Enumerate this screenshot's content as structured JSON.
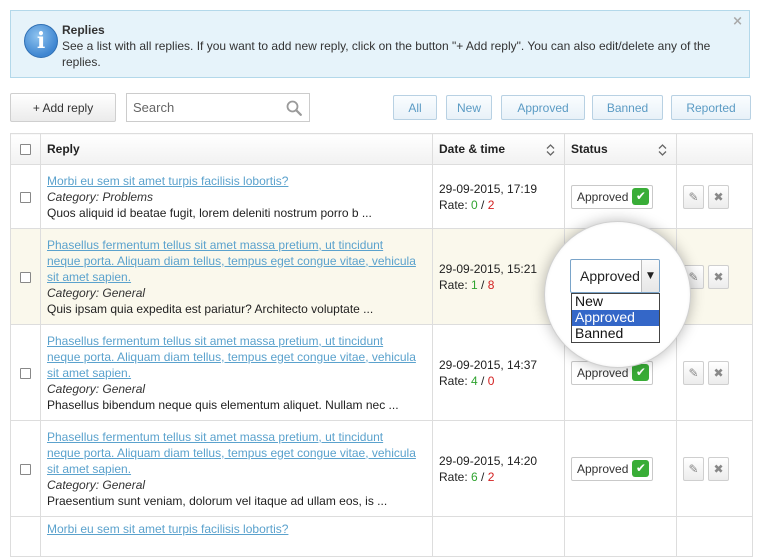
{
  "info": {
    "icon": "info-icon",
    "title": "Replies",
    "text": "See a list with all replies. If you want to add new reply, click on the button \"+ Add reply\". You can also edit/delete any of the replies.",
    "close": "×"
  },
  "toolbar": {
    "add_label": "+ Add reply",
    "search_placeholder": "Search",
    "filters": [
      "All",
      "New",
      "Approved",
      "Banned",
      "Reported"
    ]
  },
  "table": {
    "headers": {
      "reply": "Reply",
      "date": "Date & time",
      "status": "Status"
    },
    "rows": [
      {
        "title_lines": [
          "Morbi eu sem sit amet turpis facilisis lobortis?"
        ],
        "category": "Category: Problems",
        "excerpt": "Quos aliquid id beatae fugit, lorem deleniti nostrum porro b ...",
        "date": "29-09-2015, 17:19",
        "rate_label": "Rate: ",
        "rate_up": "0",
        "rate_down": "2",
        "status": "Approved"
      },
      {
        "title_lines": [
          "Phasellus fermentum tellus sit amet massa pretium, ut tincidunt",
          "neque porta. Aliquam diam tellus, tempus eget congue vitae, vehicula",
          "sit amet sapien."
        ],
        "category": "Category: General",
        "excerpt": "Quis ipsam quia expedita est pariatur? Architecto voluptate ...",
        "date": "29-09-2015, 15:21",
        "rate_label": "Rate: ",
        "rate_up": "1",
        "rate_down": "8",
        "status": "Approved"
      },
      {
        "title_lines": [
          "Phasellus fermentum tellus sit amet massa pretium, ut tincidunt",
          "neque porta. Aliquam diam tellus, tempus eget congue vitae, vehicula",
          "sit amet sapien."
        ],
        "category": "Category: General",
        "excerpt": "Phasellus bibendum neque quis elementum aliquet. Nullam nec ...",
        "date": "29-09-2015, 14:37",
        "rate_label": "Rate: ",
        "rate_up": "4",
        "rate_down": "0",
        "status": "Approved"
      },
      {
        "title_lines": [
          "Phasellus fermentum tellus sit amet massa pretium, ut tincidunt",
          "neque porta. Aliquam diam tellus, tempus eget congue vitae, vehicula",
          "sit amet sapien."
        ],
        "category": "Category: General",
        "excerpt": "Praesentium sunt veniam, dolorum vel itaque ad ullam eos, is ...",
        "date": "29-09-2015, 14:20",
        "rate_label": "Rate: ",
        "rate_up": "6",
        "rate_down": "2",
        "status": "Approved"
      },
      {
        "title_lines": [
          "Morbi eu sem sit amet turpis facilisis lobortis?"
        ],
        "category": "",
        "excerpt": "",
        "date": "",
        "rate_label": "",
        "rate_up": "",
        "rate_down": "",
        "status": ""
      }
    ]
  },
  "status_dropdown": {
    "selected": "Approved",
    "options": [
      "New",
      "Approved",
      "Banned"
    ],
    "highlighted": "Approved"
  },
  "colors": {
    "link": "#5ba2cd",
    "rate_up": "#2fa32f",
    "rate_down": "#d32020",
    "highlight_row": "#faf8ec",
    "dropdown_selected": "#3467c8"
  }
}
